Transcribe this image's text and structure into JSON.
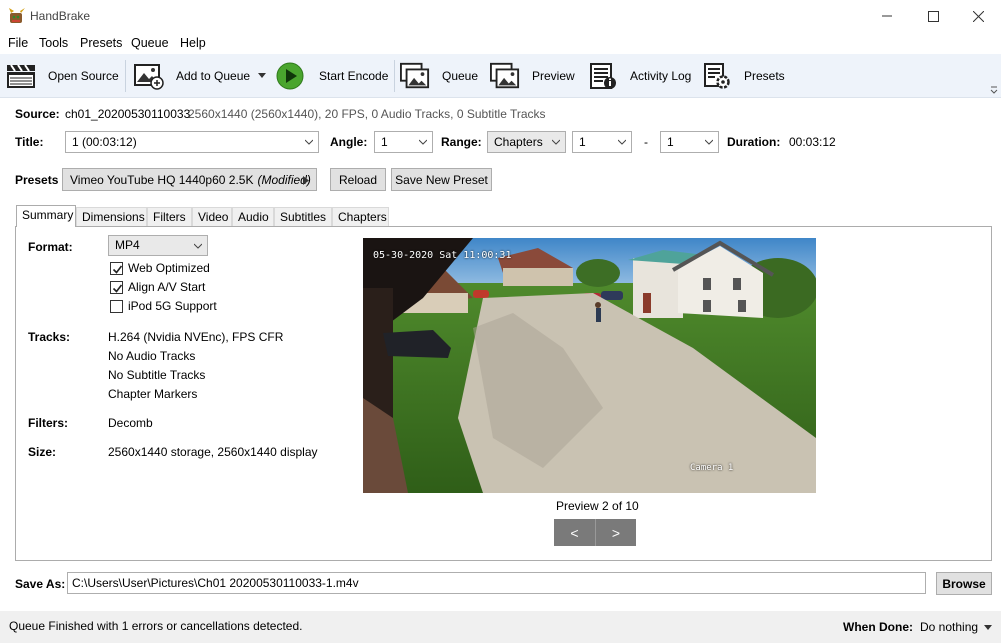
{
  "window": {
    "title": "HandBrake"
  },
  "menu": [
    "File",
    "Tools",
    "Presets",
    "Queue",
    "Help"
  ],
  "toolbar": {
    "open_source": "Open Source",
    "add_to_queue": "Add to Queue",
    "start_encode": "Start Encode",
    "queue": "Queue",
    "preview": "Preview",
    "activity_log": "Activity Log",
    "presets": "Presets"
  },
  "source": {
    "label": "Source:",
    "name": "ch01_20200530110033",
    "info": "2560x1440 (2560x1440), 20 FPS, 0 Audio Tracks, 0 Subtitle Tracks"
  },
  "title_row": {
    "title_label": "Title:",
    "title_value": "1 (00:03:12)",
    "angle_label": "Angle:",
    "angle_value": "1",
    "range_label": "Range:",
    "range_type": "Chapters",
    "range_start": "1",
    "range_dash": "-",
    "range_end": "1",
    "duration_label": "Duration:",
    "duration_value": "00:03:12"
  },
  "presets_row": {
    "label": "Presets",
    "preset_name": "Vimeo YouTube HQ 1440p60 2.5K",
    "modified": "(Modified)",
    "reload": "Reload",
    "save_new": "Save New Preset"
  },
  "tabs": [
    "Summary",
    "Dimensions",
    "Filters",
    "Video",
    "Audio",
    "Subtitles",
    "Chapters"
  ],
  "summary": {
    "format_label": "Format:",
    "format_value": "MP4",
    "web_optimized": "Web Optimized",
    "align_av": "Align A/V Start",
    "ipod": "iPod 5G Support",
    "checks": {
      "web_optimized": true,
      "align_av": true,
      "ipod": false
    },
    "tracks_label": "Tracks:",
    "tracks": [
      "H.264 (Nvidia NVEnc),  FPS CFR",
      "No Audio Tracks",
      "No Subtitle Tracks",
      "Chapter Markers"
    ],
    "filters_label": "Filters:",
    "filters_value": "Decomb",
    "size_label": "Size:",
    "size_value": "2560x1440 storage, 2560x1440 display"
  },
  "preview": {
    "timestamp": "05-30-2020 Sat 11:00:31",
    "camera": "Camera 1",
    "caption": "Preview 2 of 10",
    "prev": "<",
    "next": ">"
  },
  "save_as": {
    "label": "Save As:",
    "path": "C:\\Users\\User\\Pictures\\Ch01 20200530110033-1.m4v",
    "browse": "Browse"
  },
  "status": {
    "message": "Queue Finished with 1 errors or cancellations detected.",
    "when_done_label": "When Done:",
    "when_done_value": "Do nothing"
  }
}
